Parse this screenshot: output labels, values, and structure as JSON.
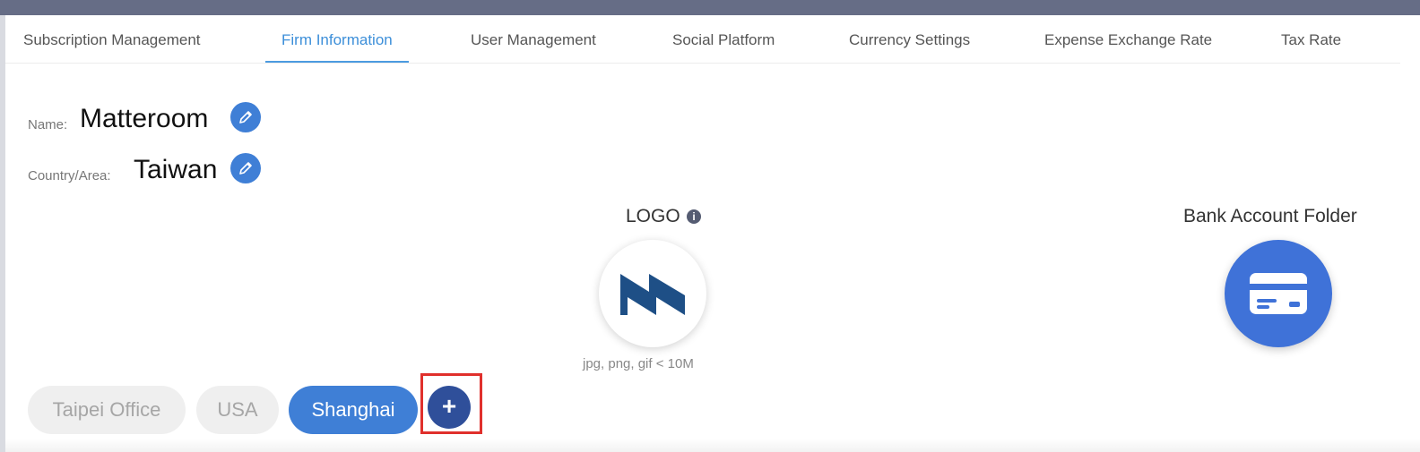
{
  "tabs": [
    {
      "label": "Subscription Management"
    },
    {
      "label": "Firm Information"
    },
    {
      "label": "User Management"
    },
    {
      "label": "Social Platform"
    },
    {
      "label": "Currency Settings"
    },
    {
      "label": "Expense Exchange Rate"
    },
    {
      "label": "Tax Rate"
    }
  ],
  "active_tab": "Firm Information",
  "firm": {
    "name_label": "Name:",
    "name_value": "Matteroom",
    "country_label": "Country/Area:",
    "country_value": "Taiwan"
  },
  "logo": {
    "title": "LOGO",
    "info_glyph": "i",
    "hint": "jpg, png, gif < 10M"
  },
  "bank": {
    "title": "Bank Account Folder"
  },
  "offices": [
    {
      "label": "Taipei Office",
      "selected": false
    },
    {
      "label": "USA",
      "selected": false
    },
    {
      "label": "Shanghai",
      "selected": true
    }
  ],
  "add_button": {
    "glyph": "+"
  },
  "colors": {
    "accent": "#3f7fd6",
    "tab_active": "#3d8fd9",
    "topbar": "#666d86",
    "highlight_box": "#e0302c",
    "logo_brand": "#1e4f86"
  },
  "icons": [
    "pencil-icon",
    "info-icon",
    "credit-card-icon",
    "plus-icon"
  ]
}
